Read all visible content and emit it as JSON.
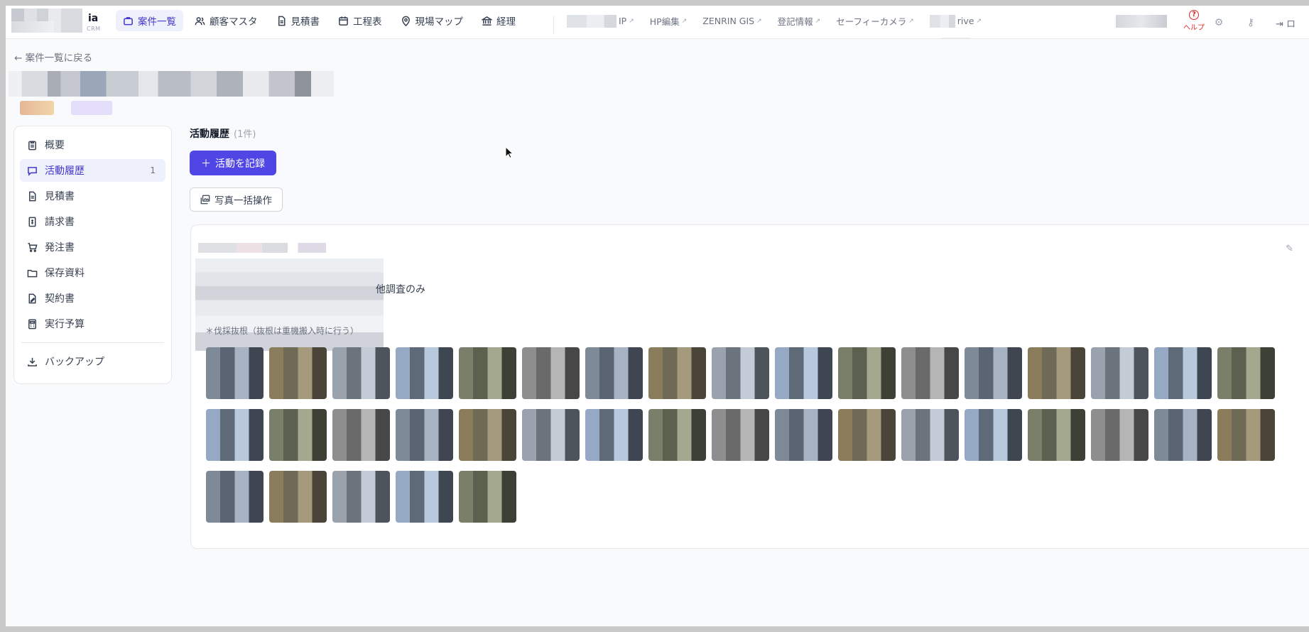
{
  "topbar": {
    "app_name": "ia",
    "app_sub": "CRM",
    "nav": [
      {
        "label": "案件一覧",
        "icon": "briefcase-icon",
        "active": true
      },
      {
        "label": "顧客マスタ",
        "icon": "users-icon",
        "active": false
      },
      {
        "label": "見積書",
        "icon": "document-icon",
        "active": false
      },
      {
        "label": "工程表",
        "icon": "calendar-icon",
        "active": false
      },
      {
        "label": "現場マップ",
        "icon": "map-pin-icon",
        "active": false
      },
      {
        "label": "経理",
        "icon": "bank-icon",
        "active": false
      }
    ],
    "external_links": [
      "IP",
      "HP編集",
      "ZENRIN GIS",
      "登記情報",
      "セーフィーカメラ",
      "rive"
    ],
    "help_label": "ヘルプ",
    "logout_label": "ロ"
  },
  "back_link": "案件一覧に戻る",
  "sidebar": {
    "items": [
      {
        "label": "概要",
        "icon": "clipboard-icon",
        "active": false
      },
      {
        "label": "活動履歴",
        "icon": "chat-icon",
        "active": true,
        "count": "1"
      },
      {
        "label": "見積書",
        "icon": "document-icon",
        "active": false
      },
      {
        "label": "請求書",
        "icon": "invoice-icon",
        "active": false
      },
      {
        "label": "発注書",
        "icon": "cart-icon",
        "active": false
      },
      {
        "label": "保存資料",
        "icon": "folder-icon",
        "active": false
      },
      {
        "label": "契約書",
        "icon": "contract-icon",
        "active": false
      },
      {
        "label": "実行予算",
        "icon": "calculator-icon",
        "active": false
      }
    ],
    "backup_label": "バックアップ"
  },
  "main": {
    "section_title": "活動履歴",
    "section_count": "(1件)",
    "record_button": "活動を記録",
    "photo_bulk_button": "写真一括操作",
    "activity": {
      "visible_text": "他調査のみ",
      "sub_text": "＊伐採抜根（抜根は重機搬入時に行う）"
    }
  },
  "colors": {
    "accent": "#4f46e5",
    "active_bg": "#eef0fb",
    "help_red": "#dc2626"
  }
}
